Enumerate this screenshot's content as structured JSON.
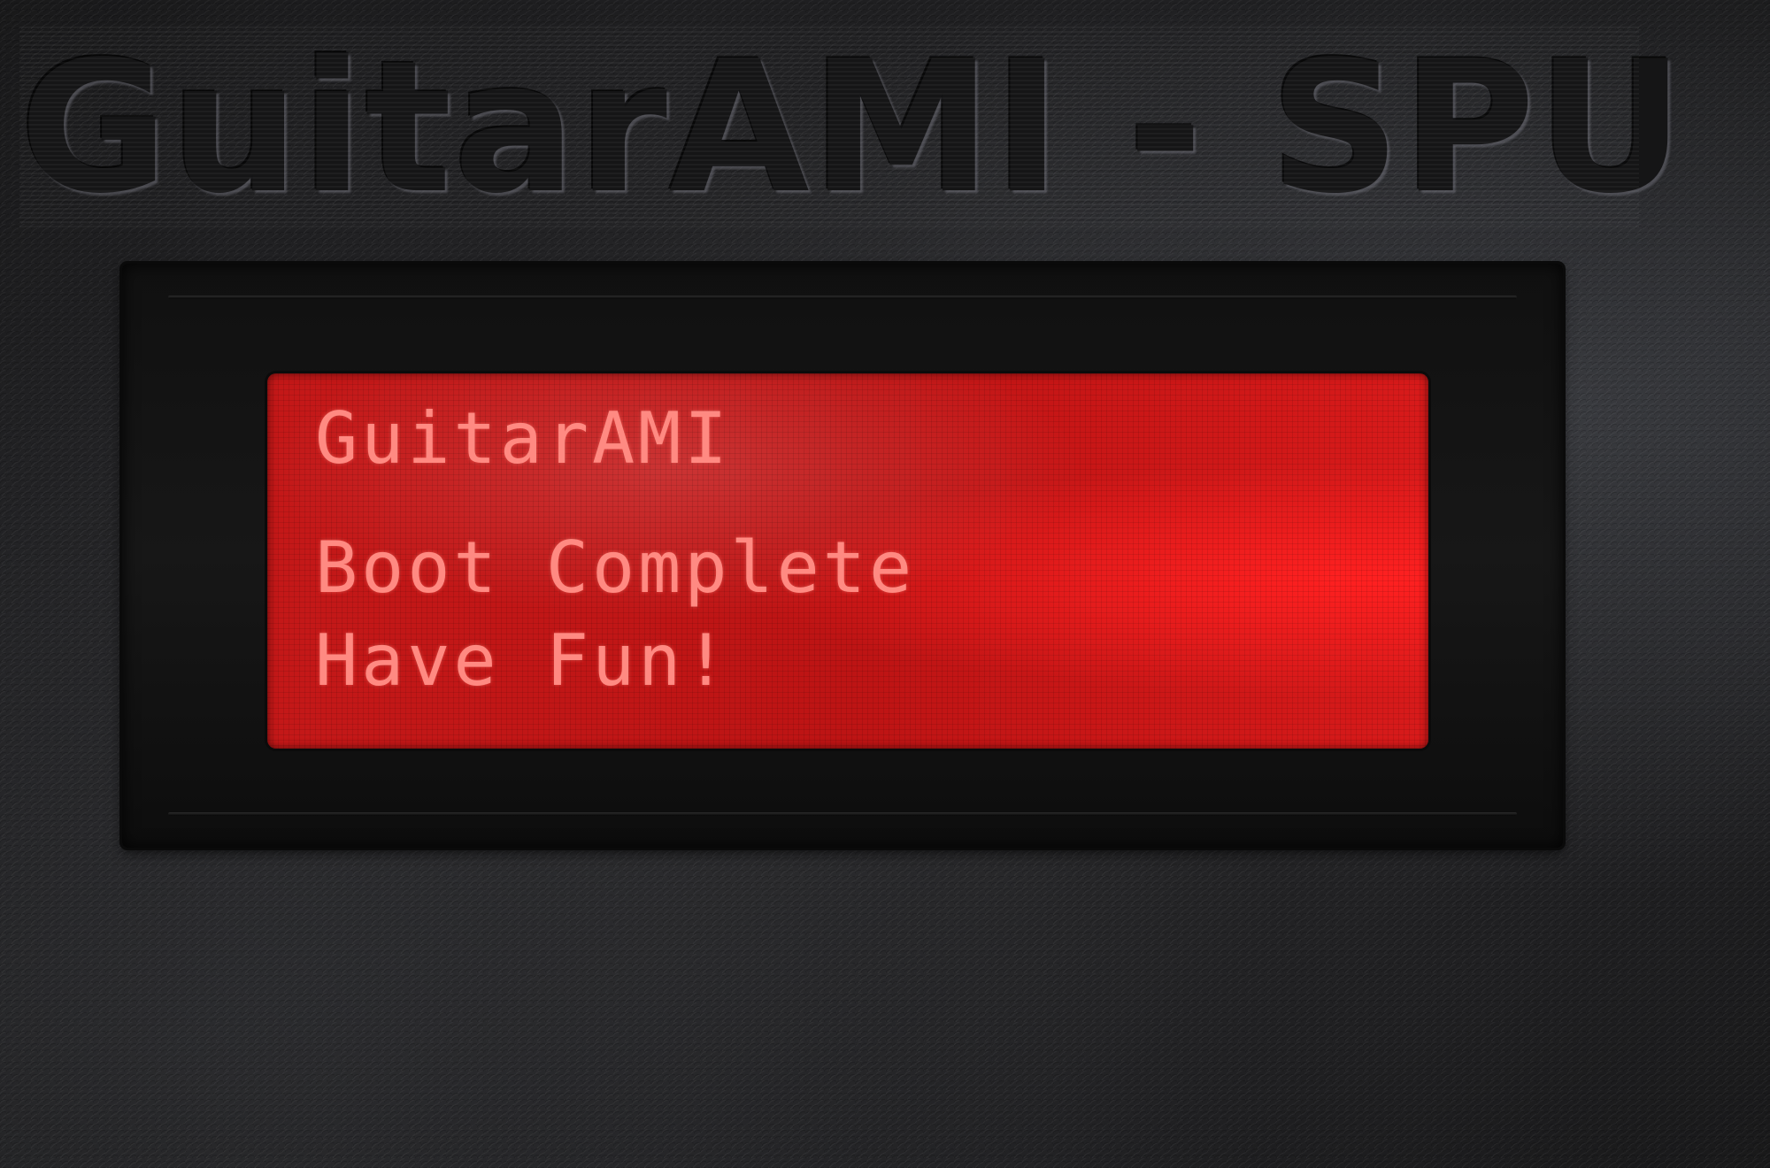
{
  "device": {
    "embossed_label": "GuitarAMI - SPU"
  },
  "lcd": {
    "lines": [
      "GuitarAMI",
      "",
      "Boot Complete",
      "Have Fun!"
    ]
  },
  "colors": {
    "enclosure": "#1f1f21",
    "lcd_background": "#c41818",
    "lcd_text": "#ff8a82"
  }
}
